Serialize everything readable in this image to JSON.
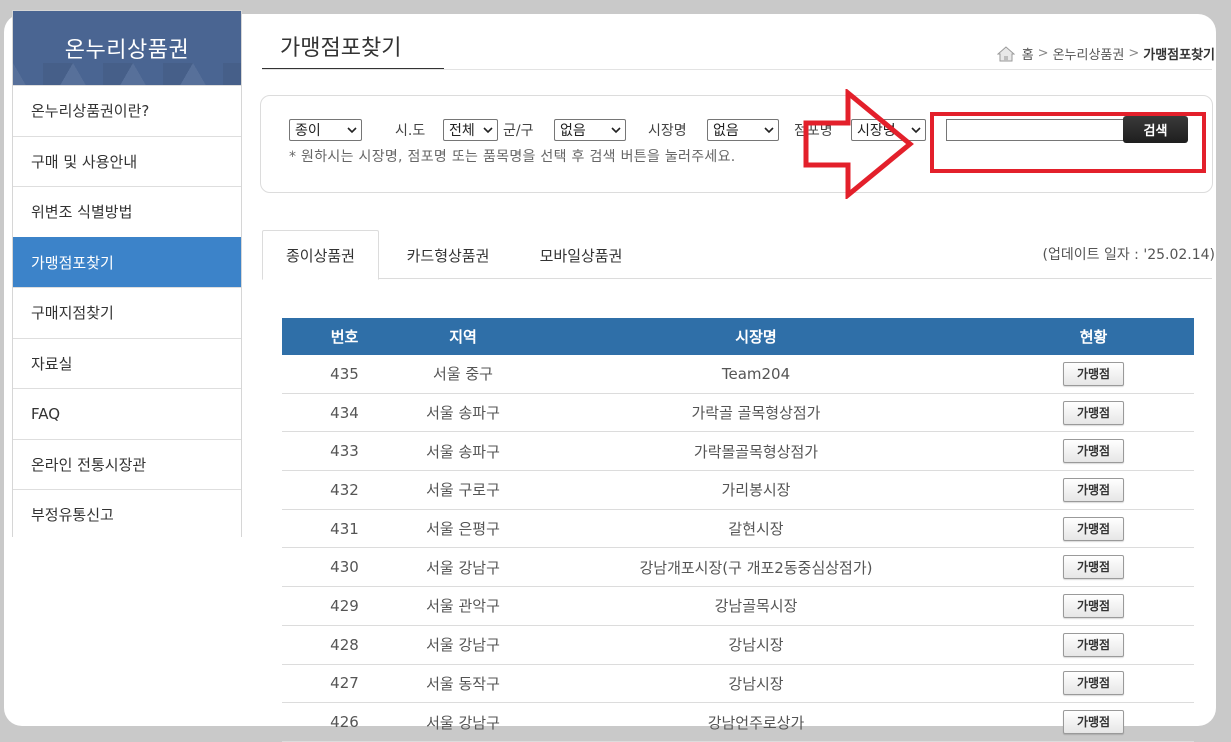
{
  "sidebar": {
    "title": "온누리상품권",
    "items": [
      {
        "label": "온누리상품권이란?"
      },
      {
        "label": "구매 및 사용안내"
      },
      {
        "label": "위변조 식별방법"
      },
      {
        "label": "가맹점포찾기"
      },
      {
        "label": "구매지점찾기"
      },
      {
        "label": "자료실"
      },
      {
        "label": "FAQ"
      },
      {
        "label": "온라인 전통시장관"
      },
      {
        "label": "부정유통신고"
      }
    ],
    "active_index": 3
  },
  "page": {
    "title": "가맹점포찾기",
    "breadcrumb": {
      "home": "홈",
      "section": "온누리상품권",
      "current": "가맹점포찾기",
      "separator": ">"
    }
  },
  "search": {
    "type_select": "종이",
    "sido_label": "시.도",
    "sido_select": "전체",
    "gungu_label": "군/구",
    "gungu_select": "없음",
    "market_label": "시장명",
    "market_select": "없음",
    "store_label": "점포명",
    "store_select": "시장명",
    "keyword_value": "",
    "button_label": "검색",
    "hint": "* 원하시는 시장명, 점포명 또는 품목명을 선택 후 검색 버튼을 눌러주세요."
  },
  "tabs": [
    {
      "label": "종이상품권",
      "active": true
    },
    {
      "label": "카드형상품권",
      "active": false
    },
    {
      "label": "모바일상품권",
      "active": false
    }
  ],
  "update_date": "(업데이트 일자 : '25.02.14)",
  "table": {
    "headers": [
      "번호",
      "지역",
      "시장명",
      "현황"
    ],
    "status_label": "가맹점",
    "rows": [
      {
        "no": "435",
        "region": "서울 중구",
        "market": "Team204"
      },
      {
        "no": "434",
        "region": "서울 송파구",
        "market": "가락골 골목형상점가"
      },
      {
        "no": "433",
        "region": "서울 송파구",
        "market": "가락몰골목형상점가"
      },
      {
        "no": "432",
        "region": "서울 구로구",
        "market": "가리봉시장"
      },
      {
        "no": "431",
        "region": "서울 은평구",
        "market": "갈현시장"
      },
      {
        "no": "430",
        "region": "서울 강남구",
        "market": "강남개포시장(구 개포2동중심상점가)"
      },
      {
        "no": "429",
        "region": "서울 관악구",
        "market": "강남골목시장"
      },
      {
        "no": "428",
        "region": "서울 강남구",
        "market": "강남시장"
      },
      {
        "no": "427",
        "region": "서울 동작구",
        "market": "강남시장"
      },
      {
        "no": "426",
        "region": "서울 강남구",
        "market": "강남언주로상가"
      }
    ]
  },
  "colors": {
    "sidebar_header": "#4a6592",
    "sidebar_active": "#3c83c9",
    "table_header": "#2f6fa8",
    "annotation_red": "#e3202b"
  }
}
